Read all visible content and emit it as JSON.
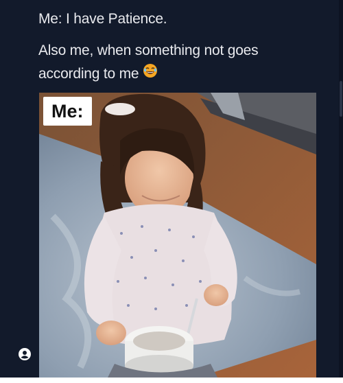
{
  "post": {
    "line1": "Me: I have Patience.",
    "line2": "Also me, when something not goes",
    "line3": "according to me",
    "emoji_icon": "laughing-face-emoji",
    "background_color": "#121a2b",
    "text_color": "#e9eaee"
  },
  "media": {
    "overlay_label": "Me:"
  },
  "icons": {
    "avatar": "user-circle-icon"
  }
}
